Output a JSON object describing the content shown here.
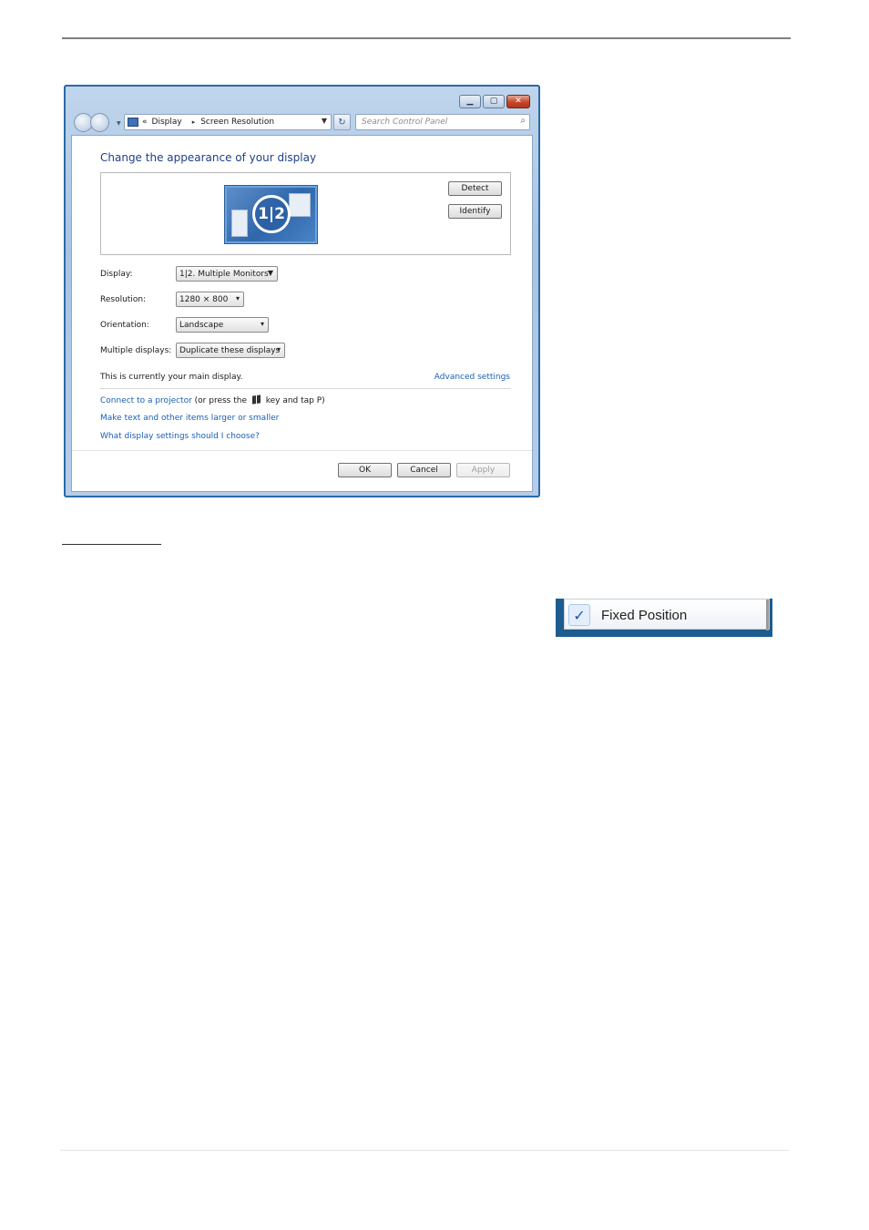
{
  "window": {
    "caption_buttons": {
      "minimize_icon": "minimize-icon",
      "maximize_icon": "maximize-icon",
      "close_icon": "close-icon"
    },
    "address_bar": {
      "prefix": "«",
      "breadcrumb": [
        "Display",
        "Screen Resolution"
      ],
      "separator": "▸"
    },
    "search": {
      "placeholder": "Search Control Panel"
    }
  },
  "content": {
    "heading": "Change the appearance of your display",
    "monitor_label": "1|2",
    "buttons": {
      "detect": "Detect",
      "identify": "Identify"
    },
    "fields": [
      {
        "label": "Display:",
        "value": "1|2. Multiple Monitors"
      },
      {
        "label": "Resolution:",
        "value": "1280 × 800"
      },
      {
        "label": "Orientation:",
        "value": "Landscape"
      },
      {
        "label": "Multiple displays:",
        "value": "Duplicate these displays"
      }
    ],
    "main_display_note": "This is currently your main display.",
    "advanced_settings": "Advanced settings",
    "projector_link": "Connect to a projector",
    "projector_suffix_1": " (or press the ",
    "projector_suffix_2": " key and tap P)",
    "text_size_link": "Make text and other items larger or smaller",
    "help_link": "What display settings should I choose?"
  },
  "footer": {
    "ok": "OK",
    "cancel": "Cancel",
    "apply": "Apply"
  },
  "context_menu": {
    "item_label": "Fixed Position",
    "checked": true,
    "check_glyph": "✓"
  }
}
